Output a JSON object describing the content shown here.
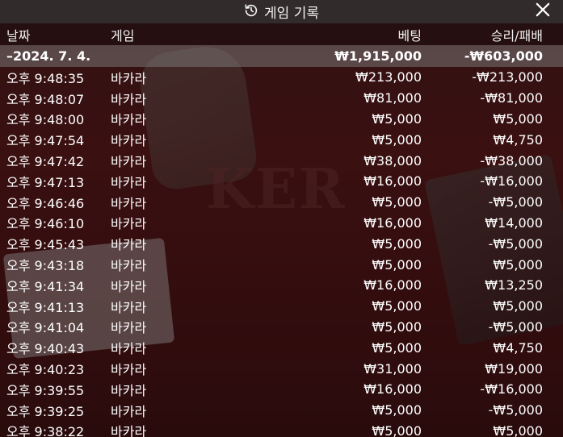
{
  "title": "게임 기록",
  "header": {
    "date": "날짜",
    "game": "게임",
    "bet": "베팅",
    "result": "승리/패배"
  },
  "group": {
    "date": "–2024. 7. 4.",
    "bet": "₩1,915,000",
    "result": "-₩603,000"
  },
  "rows": [
    {
      "time": "오후 9:48:35",
      "game": "바카라",
      "bet": "₩213,000",
      "result": "-₩213,000"
    },
    {
      "time": "오후 9:48:07",
      "game": "바카라",
      "bet": "₩81,000",
      "result": "-₩81,000"
    },
    {
      "time": "오후 9:48:00",
      "game": "바카라",
      "bet": "₩5,000",
      "result": "₩5,000"
    },
    {
      "time": "오후 9:47:54",
      "game": "바카라",
      "bet": "₩5,000",
      "result": "₩4,750"
    },
    {
      "time": "오후 9:47:42",
      "game": "바카라",
      "bet": "₩38,000",
      "result": "-₩38,000"
    },
    {
      "time": "오후 9:47:13",
      "game": "바카라",
      "bet": "₩16,000",
      "result": "-₩16,000"
    },
    {
      "time": "오후 9:46:46",
      "game": "바카라",
      "bet": "₩5,000",
      "result": "-₩5,000"
    },
    {
      "time": "오후 9:46:10",
      "game": "바카라",
      "bet": "₩16,000",
      "result": "₩14,000"
    },
    {
      "time": "오후 9:45:43",
      "game": "바카라",
      "bet": "₩5,000",
      "result": "-₩5,000"
    },
    {
      "time": "오후 9:43:18",
      "game": "바카라",
      "bet": "₩5,000",
      "result": "₩5,000"
    },
    {
      "time": "오후 9:41:34",
      "game": "바카라",
      "bet": "₩16,000",
      "result": "₩13,250"
    },
    {
      "time": "오후 9:41:13",
      "game": "바카라",
      "bet": "₩5,000",
      "result": "₩5,000"
    },
    {
      "time": "오후 9:41:04",
      "game": "바카라",
      "bet": "₩5,000",
      "result": "-₩5,000"
    },
    {
      "time": "오후 9:40:43",
      "game": "바카라",
      "bet": "₩5,000",
      "result": "₩4,750"
    },
    {
      "time": "오후 9:40:23",
      "game": "바카라",
      "bet": "₩31,000",
      "result": "₩19,000"
    },
    {
      "time": "오후 9:39:55",
      "game": "바카라",
      "bet": "₩16,000",
      "result": "-₩16,000"
    },
    {
      "time": "오후 9:39:25",
      "game": "바카라",
      "bet": "₩5,000",
      "result": "-₩5,000"
    },
    {
      "time": "오후 9:38:22",
      "game": "바카라",
      "bet": "₩5,000",
      "result": "₩5,000"
    }
  ],
  "icons": {
    "title": "history-icon",
    "close": "close-icon"
  },
  "colors": {
    "text": "#ffffff",
    "titlebar": "#322e2e",
    "date_row": "#787474"
  },
  "background_text": "KER"
}
